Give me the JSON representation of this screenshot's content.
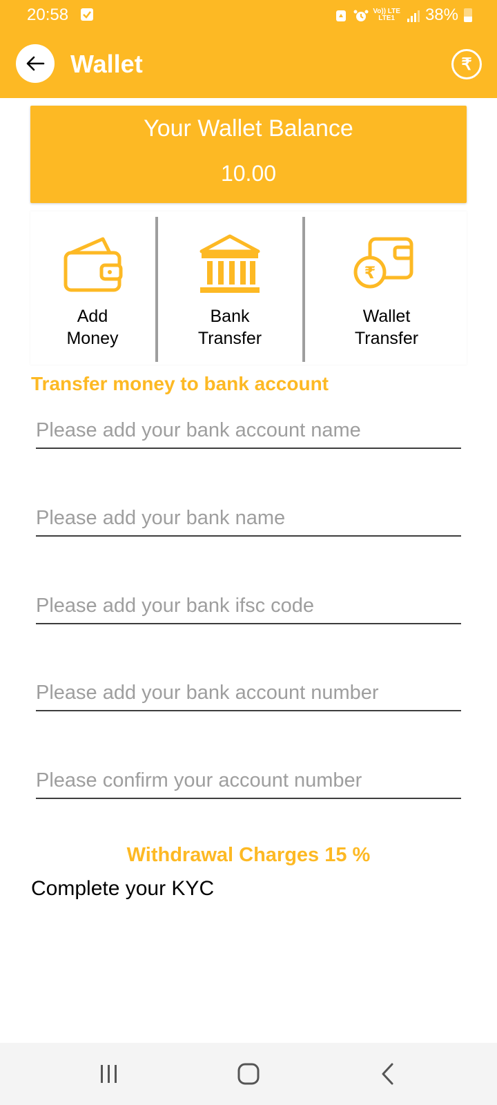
{
  "status_bar": {
    "time": "20:58",
    "network_top": "Vo)) LTE",
    "network_bottom": "LTE1",
    "battery": "38%"
  },
  "app_bar": {
    "title": "Wallet",
    "back_icon": "arrow-left-icon",
    "currency_icon": "rupee-icon",
    "currency_symbol": "₹"
  },
  "balance": {
    "label": "Your Wallet Balance",
    "value": "10.00"
  },
  "actions": [
    {
      "line1": "Add",
      "line2": "Money",
      "icon": "wallet-icon"
    },
    {
      "line1": "Bank",
      "line2": "Transfer",
      "icon": "bank-icon"
    },
    {
      "line1": "Wallet",
      "line2": "Transfer",
      "icon": "wallet-rupee-icon"
    }
  ],
  "form": {
    "title": "Transfer money to bank account",
    "account_name_placeholder": "Please add your bank account name",
    "bank_name_placeholder": "Please add your bank name",
    "ifsc_placeholder": "Please add your bank ifsc code",
    "account_number_placeholder": "Please add your bank account number",
    "confirm_account_placeholder": "Please confirm your account number"
  },
  "charges_text": "Withdrawal Charges 15 %",
  "kyc_text": "Complete your KYC",
  "colors": {
    "accent": "#FDB924",
    "text": "#000000",
    "placeholder": "#9E9E9E",
    "nav_background": "#F4F4F4"
  }
}
